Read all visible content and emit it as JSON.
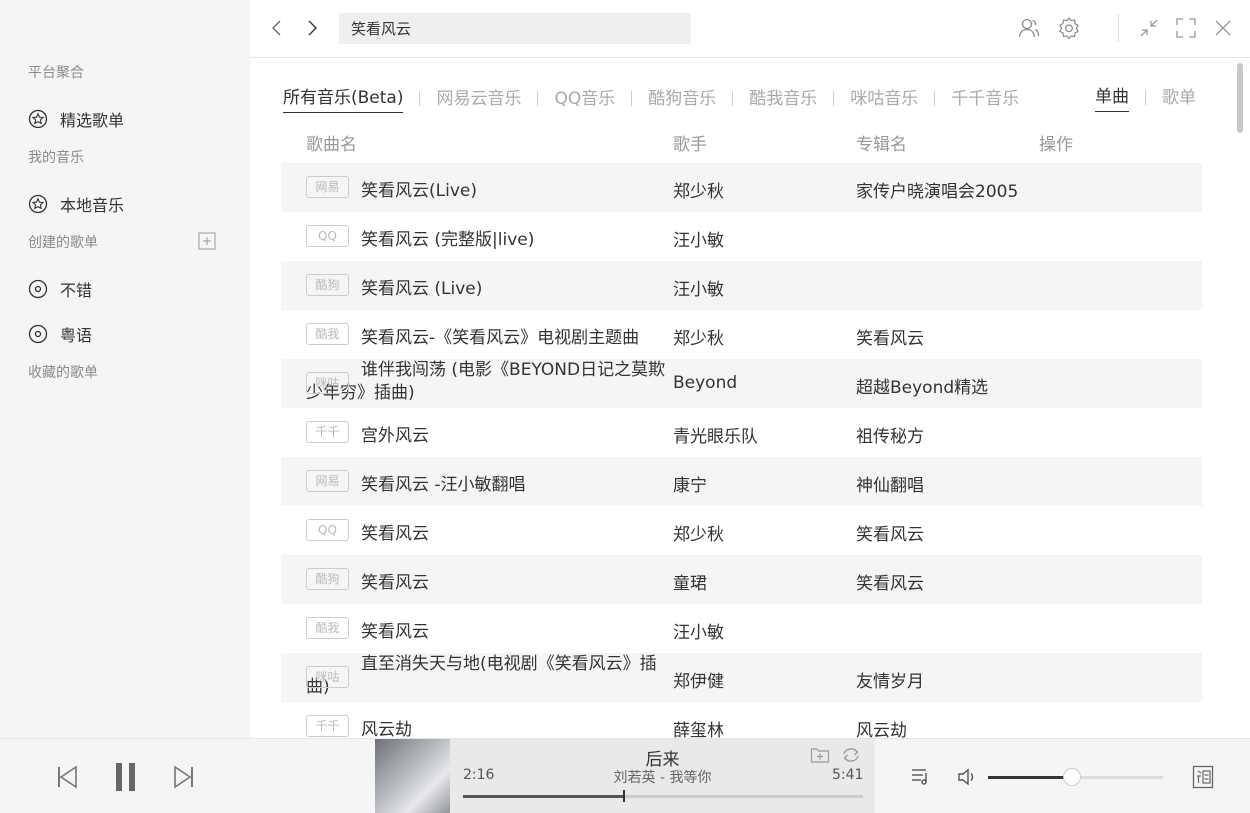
{
  "sidebar": {
    "section_platform": "平台聚合",
    "item_featured": "精选歌单",
    "section_my_music": "我的音乐",
    "item_local": "本地音乐",
    "section_created": "创建的歌单",
    "playlists": [
      {
        "label": "不错"
      },
      {
        "label": "粤语"
      }
    ],
    "section_favorite": "收藏的歌单"
  },
  "search": {
    "value": "笑看风云"
  },
  "source_tabs": [
    {
      "label": "所有音乐(Beta)",
      "active": true
    },
    {
      "label": "网易云音乐",
      "active": false
    },
    {
      "label": "QQ音乐",
      "active": false
    },
    {
      "label": "酷狗音乐",
      "active": false
    },
    {
      "label": "酷我音乐",
      "active": false
    },
    {
      "label": "咪咕音乐",
      "active": false
    },
    {
      "label": "千千音乐",
      "active": false
    }
  ],
  "type_tabs": [
    {
      "label": "单曲",
      "active": true
    },
    {
      "label": "歌单",
      "active": false
    }
  ],
  "table": {
    "headers": {
      "title": "歌曲名",
      "artist": "歌手",
      "album": "专辑名",
      "action": "操作"
    },
    "rows": [
      {
        "source": "网易",
        "title": "笑看风云(Live)",
        "artist": "郑少秋",
        "album": "家传户晓演唱会2005",
        "wrap": false
      },
      {
        "source": "QQ",
        "title": "笑看风云 (完整版|live)",
        "artist": "汪小敏",
        "album": "",
        "wrap": false
      },
      {
        "source": "酷狗",
        "title": "笑看风云 (Live)",
        "artist": "汪小敏",
        "album": "",
        "wrap": false
      },
      {
        "source": "酷我",
        "title": "笑看风云-《笑看风云》电视剧主题曲",
        "artist": "郑少秋",
        "album": "笑看风云",
        "wrap": false
      },
      {
        "source": "咪咕",
        "title": "谁伴我闯荡 (电影《BEYOND日记之莫欺少年穷》插曲)",
        "artist": "Beyond",
        "album": "超越Beyond精选",
        "wrap": true
      },
      {
        "source": "千千",
        "title": "宫外风云",
        "artist": "青光眼乐队",
        "album": "祖传秘方",
        "wrap": false
      },
      {
        "source": "网易",
        "title": "笑看风云 -汪小敏翻唱",
        "artist": "康宁",
        "album": "神仙翻唱",
        "wrap": false
      },
      {
        "source": "QQ",
        "title": "笑看风云",
        "artist": "郑少秋",
        "album": "笑看风云",
        "wrap": false
      },
      {
        "source": "酷狗",
        "title": "笑看风云",
        "artist": "童珺",
        "album": "笑看风云",
        "wrap": false
      },
      {
        "source": "酷我",
        "title": "笑看风云",
        "artist": "汪小敏",
        "album": "",
        "wrap": false
      },
      {
        "source": "咪咕",
        "title": "直至消失天与地(电视剧《笑看风云》插曲)",
        "artist": "郑伊健",
        "album": "友情岁月",
        "wrap": true
      },
      {
        "source": "千千",
        "title": "风云劫",
        "artist": "薛玺林",
        "album": "风云劫",
        "wrap": false
      }
    ]
  },
  "player": {
    "song_title": "后来",
    "song_subtitle": "刘若英 - 我等你",
    "current_time": "2:16",
    "total_time": "5:41",
    "progress_fraction": 0.4,
    "volume_fraction": 0.48
  }
}
